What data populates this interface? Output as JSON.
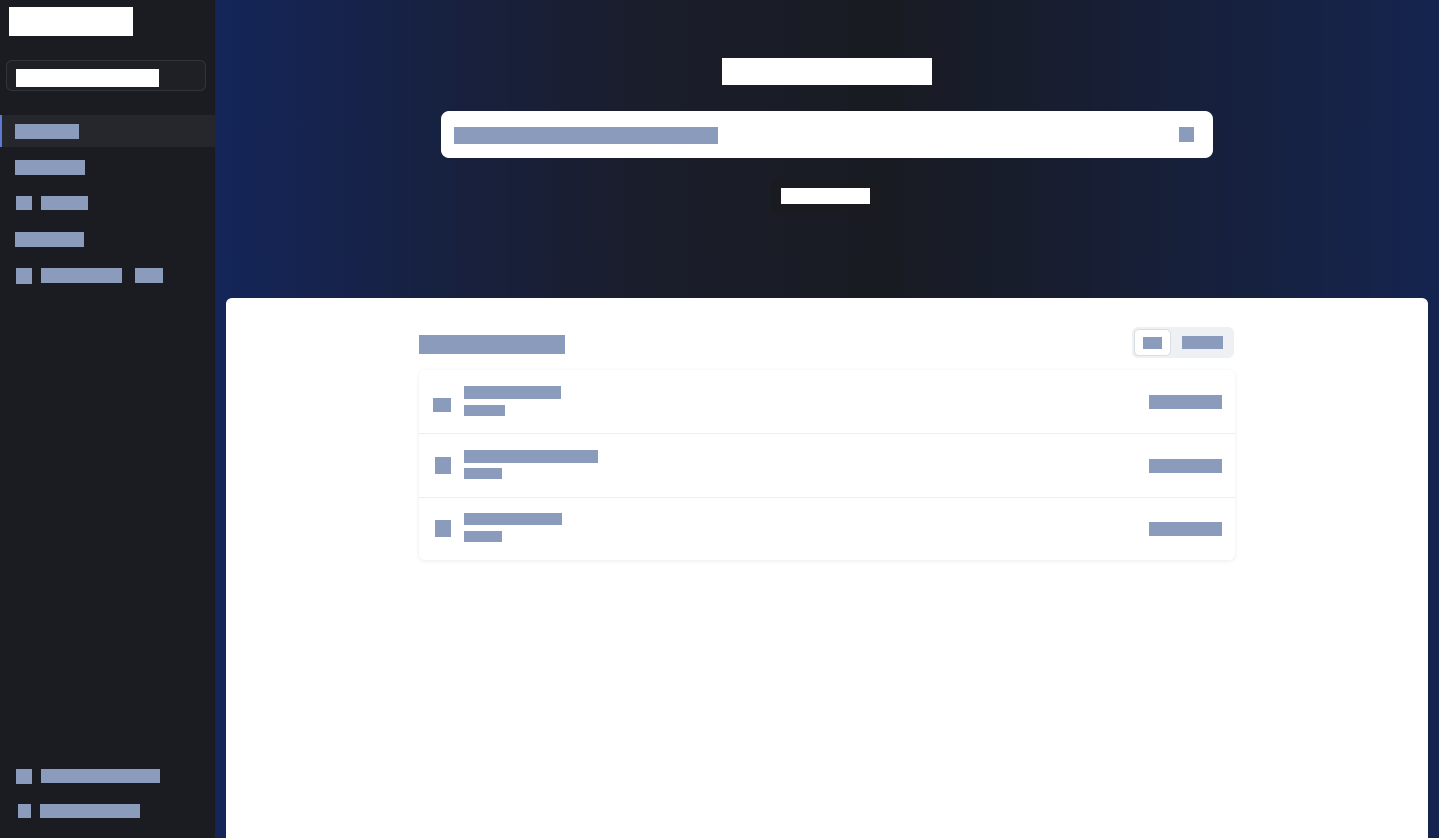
{
  "sidebar": {
    "logo": "",
    "search_placeholder": "",
    "items": [
      {
        "label": "",
        "icon": "none",
        "active": true
      },
      {
        "label": "",
        "icon": "none",
        "active": false
      },
      {
        "label": "",
        "icon": "square-icon",
        "active": false
      },
      {
        "label": "",
        "icon": "none",
        "active": false
      },
      {
        "label": "",
        "icon": "square-icon",
        "active": false,
        "badge": ""
      }
    ],
    "footer": [
      {
        "label": "",
        "icon": "square-icon"
      },
      {
        "label": "",
        "icon": "square-icon"
      }
    ]
  },
  "hero": {
    "title": "",
    "search_placeholder": "",
    "search_icon": "square-icon",
    "chip_label": ""
  },
  "panel": {
    "heading": "",
    "view_toggle": [
      "",
      ""
    ],
    "rows": [
      {
        "title": "",
        "subtitle": "",
        "meta": "",
        "icon": "folder-icon"
      },
      {
        "title": "",
        "subtitle": "",
        "meta": "",
        "icon": "file-icon"
      },
      {
        "title": "",
        "subtitle": "",
        "meta": "",
        "icon": "file-icon"
      }
    ]
  },
  "colors": {
    "sidebar_bg": "#1b1c21",
    "hero_gradient_start": "#142558",
    "hero_gradient_end": "#15244f",
    "redaction_muted": "#8a9bbb",
    "accent": "#5b7bd5"
  }
}
